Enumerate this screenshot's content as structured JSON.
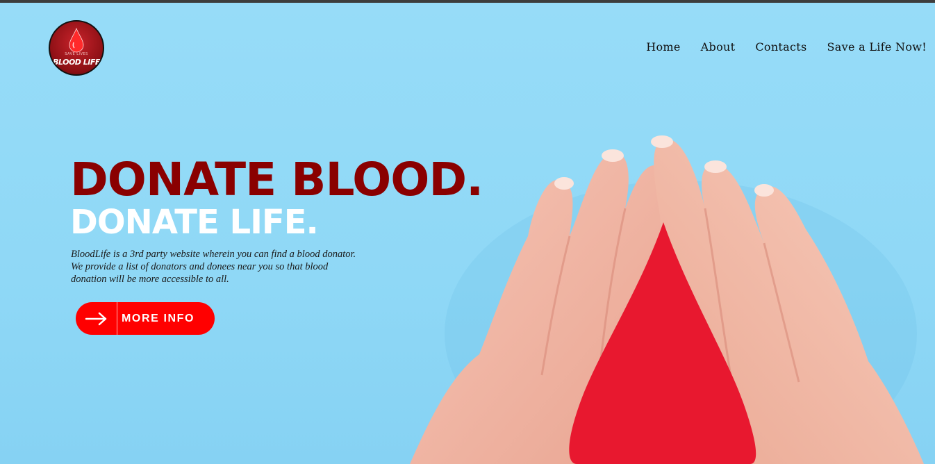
{
  "logo": {
    "tagline": "SAVE LIVES",
    "name": "BLOOD LIFE"
  },
  "nav": {
    "items": [
      "Home",
      "About",
      "Contacts",
      "Save a Life Now!"
    ]
  },
  "hero": {
    "headline": "DONATE BLOOD.",
    "subheadline": "DONATE LIFE.",
    "description": "BloodLife is a 3rd party website wherein you can find a blood donator. We provide a list of donators and donees near you so that blood donation will be more accessible to all.",
    "cta_label": "MORE INFO",
    "cta_icon": "arrow-right-icon"
  },
  "colors": {
    "background": "#95dcf7",
    "headline": "#8a0000",
    "subheadline": "#ffffff",
    "cta": "#ff0000",
    "blood_drop": "#e8182f"
  }
}
